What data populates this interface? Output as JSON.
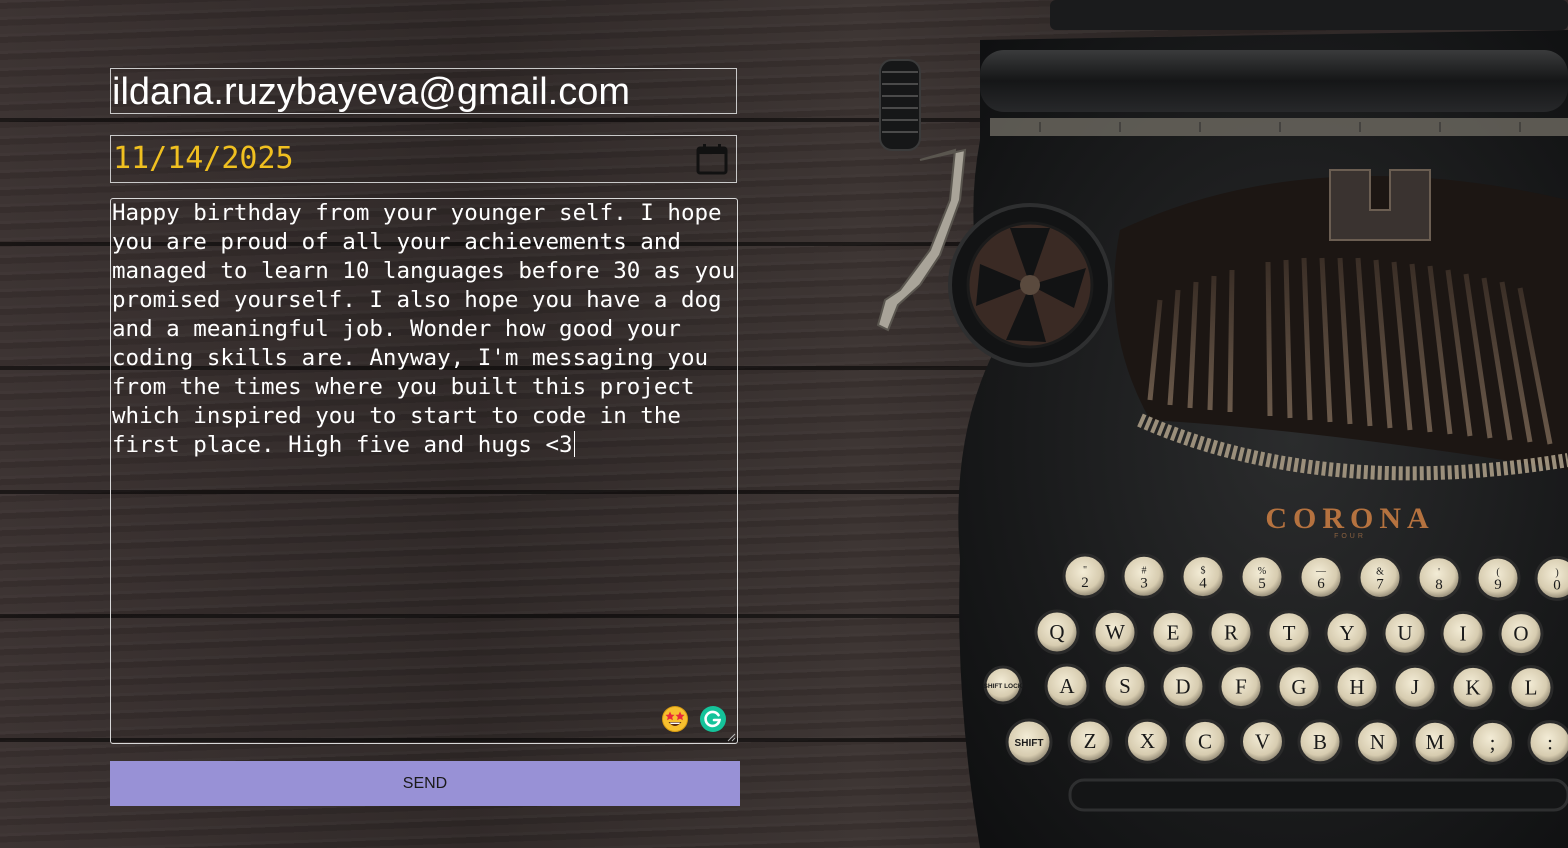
{
  "form": {
    "email": "ildana.ruzybayeva@gmail.com",
    "date": "11/14/2025",
    "message": "Happy birthday from your younger self. I hope you are proud of all your achievements and managed to learn 10 languages before 30 as you promised yourself. I also hope you have a dog and a meaningful job. Wonder how good your coding skills are. Anyway, I'm messaging you from the times where you built this project which inspired you to start to code in the first place. High five and hugs <3",
    "send_label": "SEND"
  },
  "colors": {
    "date_text": "#f0c020",
    "send_button_bg": "#9891d6",
    "field_border": "#c9c9c9",
    "grammarly": "#15c39a"
  },
  "icons": [
    "calendar-icon",
    "star-struck-emoji-icon",
    "grammarly-icon",
    "resize-handle-icon"
  ],
  "typewriter": {
    "brand": "CORONA",
    "model": "FOUR",
    "number_row": [
      [
        "\"",
        "2"
      ],
      [
        "#",
        "3"
      ],
      [
        "$",
        "4"
      ],
      [
        "%",
        "5"
      ],
      [
        "—",
        "6"
      ],
      [
        "&",
        "7"
      ],
      [
        "'",
        "8"
      ],
      [
        "(",
        "9"
      ],
      [
        ")",
        "0"
      ]
    ],
    "qwerty_row": [
      "Q",
      "W",
      "E",
      "R",
      "T",
      "Y",
      "U",
      "I",
      "O"
    ],
    "home_row": [
      "A",
      "S",
      "D",
      "F",
      "G",
      "H",
      "J",
      "K",
      "L"
    ],
    "bottom_row": [
      "Z",
      "X",
      "C",
      "V",
      "B",
      "N",
      "M",
      ";",
      ":"
    ],
    "shift_lock_label": "SHIFT LOCK",
    "shift_label": "SHIFT"
  }
}
